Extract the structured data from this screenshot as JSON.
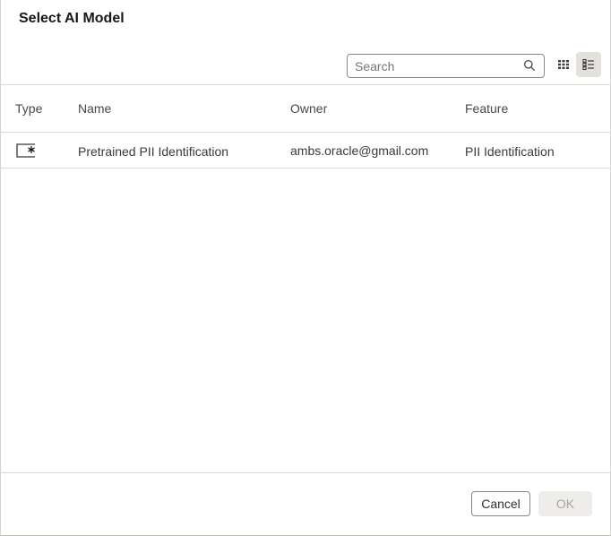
{
  "dialog": {
    "title": "Select AI Model"
  },
  "toolbar": {
    "search_placeholder": "Search",
    "search_value": "",
    "grid_view_icon": "grid-icon",
    "list_view_icon": "list-icon",
    "active_view": "list"
  },
  "table": {
    "columns": [
      "Type",
      "Name",
      "Owner",
      "Feature"
    ],
    "rows": [
      {
        "type_icon": "model-asterisk-icon",
        "name": "Pretrained PII Identification",
        "owner": "ambs.oracle@gmail.com",
        "feature": "PII Identification"
      }
    ]
  },
  "footer": {
    "cancel_label": "Cancel",
    "ok_label": "OK",
    "ok_enabled": false
  }
}
